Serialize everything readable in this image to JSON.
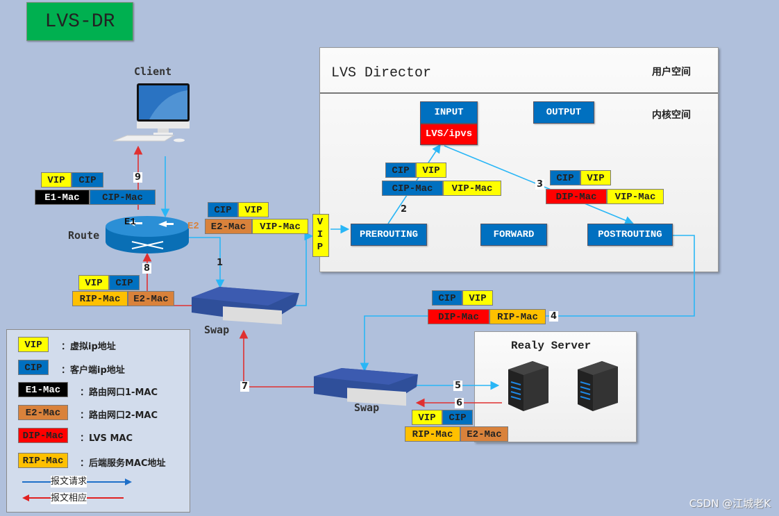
{
  "title": "LVS-DR",
  "nodes": {
    "client": "Client",
    "route": "Route",
    "e1": "E1",
    "e2": "E2",
    "swap_top": "Swap",
    "swap_bottom": "Swap",
    "vip_port": "VIP",
    "director_title": "LVS Director",
    "user_space": "用户空间",
    "kernel_space": "内核空间",
    "real_server": "Realy Server"
  },
  "hooks": {
    "input": "INPUT",
    "lvs_ipvs": "LVS/ipvs",
    "output": "OUTPUT",
    "prerouting": "PREROUTING",
    "forward": "FORWARD",
    "postrouting": "POSTROUTING"
  },
  "packets": {
    "p9": {
      "ip": [
        "VIP",
        "CIP"
      ],
      "mac": [
        "E1-Mac",
        "CIP-Mac"
      ]
    },
    "p1": {
      "ip": [
        "CIP",
        "VIP"
      ],
      "mac": [
        "E2-Mac",
        "VIP-Mac"
      ]
    },
    "p8": {
      "ip": [
        "VIP",
        "CIP"
      ],
      "mac": [
        "RIP-Mac",
        "E2-Mac"
      ]
    },
    "p2": {
      "ip": [
        "CIP",
        "VIP"
      ],
      "mac": [
        "CIP-Mac",
        "VIP-Mac"
      ]
    },
    "p3": {
      "ip": [
        "CIP",
        "VIP"
      ],
      "mac": [
        "DIP-Mac",
        "VIP-Mac"
      ]
    },
    "p4": {
      "ip": [
        "CIP",
        "VIP"
      ],
      "mac": [
        "DIP-Mac",
        "RIP-Mac"
      ]
    },
    "p6": {
      "ip": [
        "VIP",
        "CIP"
      ],
      "mac": [
        "RIP-Mac",
        "E2-Mac"
      ]
    }
  },
  "steps": [
    "1",
    "2",
    "3",
    "4",
    "5",
    "6",
    "7",
    "8",
    "9"
  ],
  "legend": {
    "items": [
      {
        "tag": "VIP",
        "text": "：虚拟ip地址"
      },
      {
        "tag": "CIP",
        "text": "：客户端ip地址"
      },
      {
        "tag": "E1-Mac",
        "text": "：路由网口1-MAC"
      },
      {
        "tag": "E2-Mac",
        "text": "：路由网口2-MAC"
      },
      {
        "tag": "DIP-Mac",
        "text": "：LVS MAC"
      },
      {
        "tag": "RIP-Mac",
        "text": "：后端服务MAC地址"
      }
    ],
    "request": "报文请求",
    "response": "报文相应"
  },
  "colors": {
    "background": "#b0c0dc",
    "request_line": "#29b6f6",
    "response_line": "#e03030",
    "vip": "#ffff00",
    "cip": "#0070c0",
    "e1_mac": "#000000",
    "e2_mac": "#d9823b",
    "dip_mac": "#ff0000",
    "rip_mac": "#ffc000"
  },
  "watermark": "CSDN @江城老K"
}
